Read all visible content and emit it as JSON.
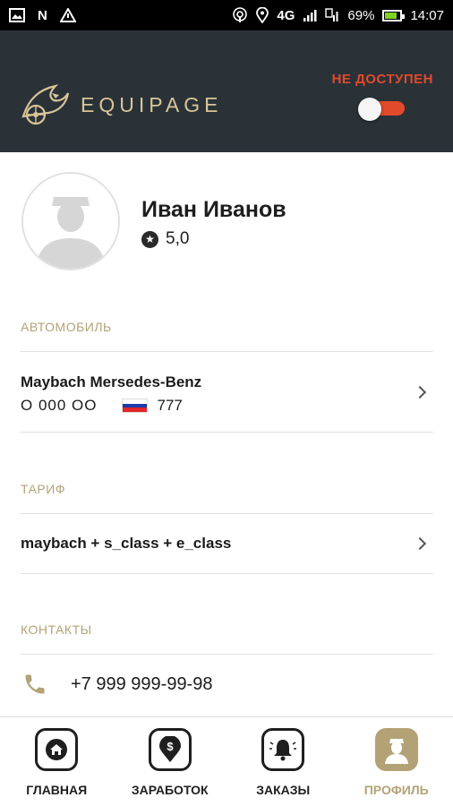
{
  "status_bar": {
    "left_glyphs": [
      "N"
    ],
    "network": "4G",
    "battery": "69%",
    "time": "14:07"
  },
  "header": {
    "logo_text": "EQUIPAGE",
    "availability_label": "НЕ ДОСТУПЕН",
    "toggle_on": false,
    "accent_color": "#e14a2a",
    "brand_color": "#b3a275",
    "background_color": "#2a3238"
  },
  "profile": {
    "name": "Иван Иванов",
    "rating": "5,0"
  },
  "car_section": {
    "title": "АВТОМОБИЛЬ",
    "model": "Maybach Mersedes-Benz",
    "plate_number": "О 000 ОО",
    "region": "777"
  },
  "tariff_section": {
    "title": "ТАРИФ",
    "value": "maybach + s_class + e_class"
  },
  "contacts_section": {
    "title": "КОНТАКТЫ",
    "phone": "+7 999 999-99-98"
  },
  "bottom_nav": {
    "items": [
      {
        "label": "ГЛАВНАЯ",
        "icon": "home-icon",
        "active": false
      },
      {
        "label": "ЗАРАБОТОК",
        "icon": "earnings-icon",
        "active": false
      },
      {
        "label": "ЗАКАЗЫ",
        "icon": "bell-icon",
        "active": false
      },
      {
        "label": "ПРОФИЛЬ",
        "icon": "profile-icon",
        "active": true
      }
    ]
  }
}
